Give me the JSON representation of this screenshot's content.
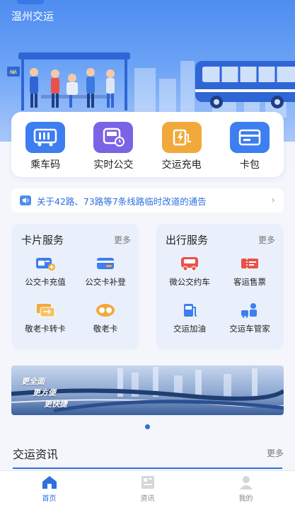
{
  "app": {
    "title": "温州交运"
  },
  "quick": [
    {
      "label": "乘车码",
      "icon": "bus-qr-icon",
      "color": "#3d7ef0"
    },
    {
      "label": "实时公交",
      "icon": "bus-clock-icon",
      "color": "#7b63e6"
    },
    {
      "label": "交运充电",
      "icon": "charging-icon",
      "color": "#f2a93b"
    },
    {
      "label": "卡包",
      "icon": "card-wallet-icon",
      "color": "#3d7ef0"
    }
  ],
  "notice": {
    "text": "关于42路、73路等7条线路临时改道的通告"
  },
  "card_service": {
    "title": "卡片服务",
    "more": "更多",
    "items": [
      {
        "label": "公交卡充值",
        "icon": "bus-card-topup-icon"
      },
      {
        "label": "公交卡补登",
        "icon": "bus-card-register-icon"
      },
      {
        "label": "敬老卡转卡",
        "icon": "senior-card-transfer-icon"
      },
      {
        "label": "敬老卡",
        "icon": "senior-card-icon"
      }
    ]
  },
  "travel_service": {
    "title": "出行服务",
    "more": "更多",
    "items": [
      {
        "label": "微公交约车",
        "icon": "micro-bus-icon"
      },
      {
        "label": "客运售票",
        "icon": "ticket-icon"
      },
      {
        "label": "交运加油",
        "icon": "fuel-icon"
      },
      {
        "label": "交运车管家",
        "icon": "car-steward-icon"
      }
    ]
  },
  "banner": {
    "line1": "更全面",
    "line2": "更方便",
    "line3": "更快捷"
  },
  "news": {
    "title": "交运资讯",
    "more": "更多"
  },
  "tabbar": [
    {
      "label": "首页",
      "icon": "home-icon",
      "active": true
    },
    {
      "label": "资讯",
      "icon": "news-icon",
      "active": false
    },
    {
      "label": "我的",
      "icon": "profile-icon",
      "active": false
    }
  ]
}
